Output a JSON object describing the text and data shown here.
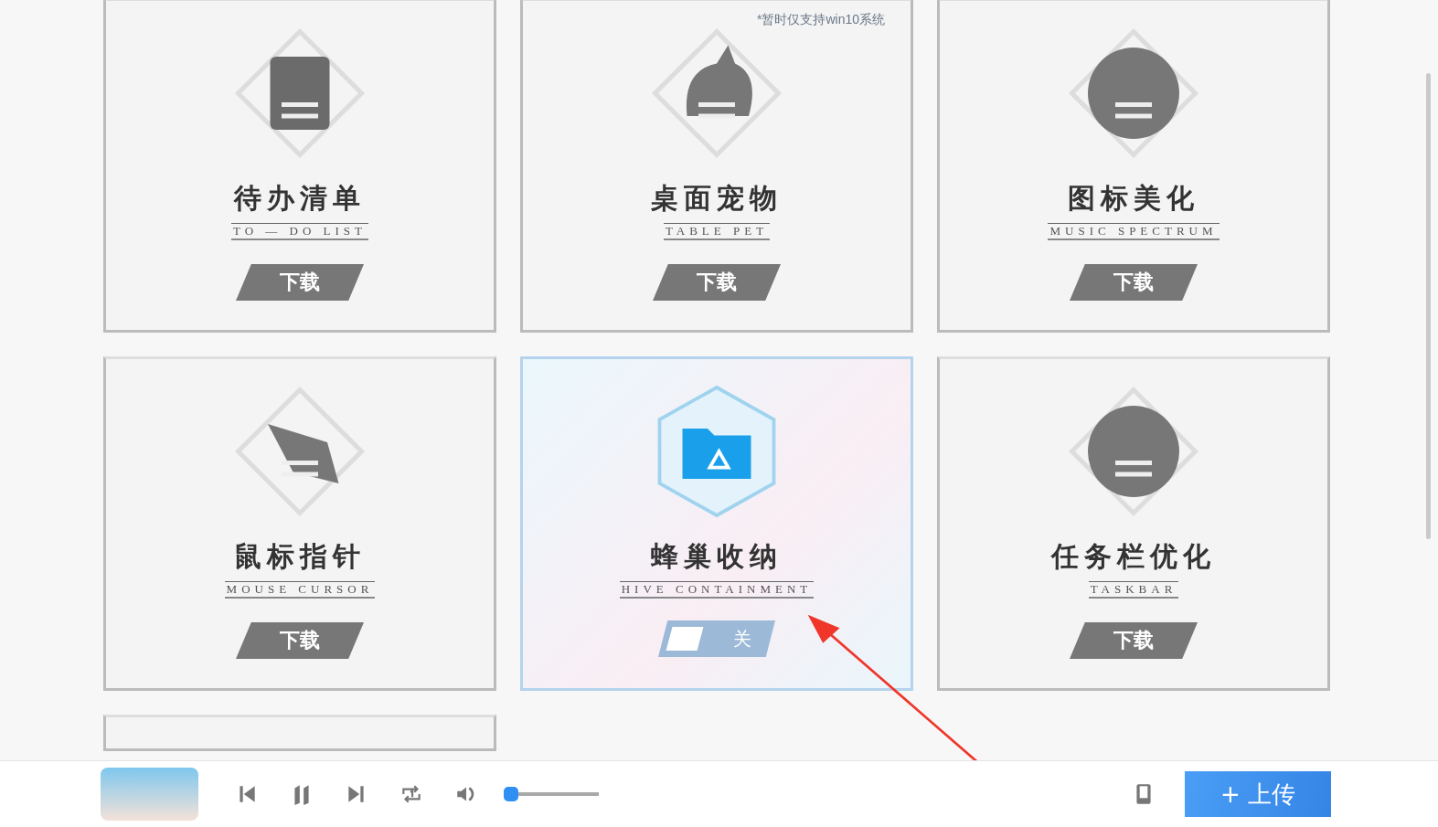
{
  "note": "*暂时仅支持win10系统",
  "cards": [
    {
      "kind": "download",
      "title": "待办清单",
      "subtitle": "TO — DO LIST",
      "button": "下载"
    },
    {
      "kind": "download",
      "title": "桌面宠物",
      "subtitle": "TABLE PET",
      "button": "下载"
    },
    {
      "kind": "download",
      "title": "图标美化",
      "subtitle": "MUSIC SPECTRUM",
      "button": "下载"
    },
    {
      "kind": "download",
      "title": "鼠标指针",
      "subtitle": "MOUSE CURSOR",
      "button": "下载"
    },
    {
      "kind": "toggle",
      "title": "蜂巢收纳",
      "subtitle": "HIVE CONTAINMENT",
      "button": "关",
      "on": false
    },
    {
      "kind": "download",
      "title": "任务栏优化",
      "subtitle": "TASKBAR",
      "button": "下载"
    }
  ],
  "player": {
    "volume": {
      "level": 0.0
    },
    "upload_button": "+ 上传"
  }
}
